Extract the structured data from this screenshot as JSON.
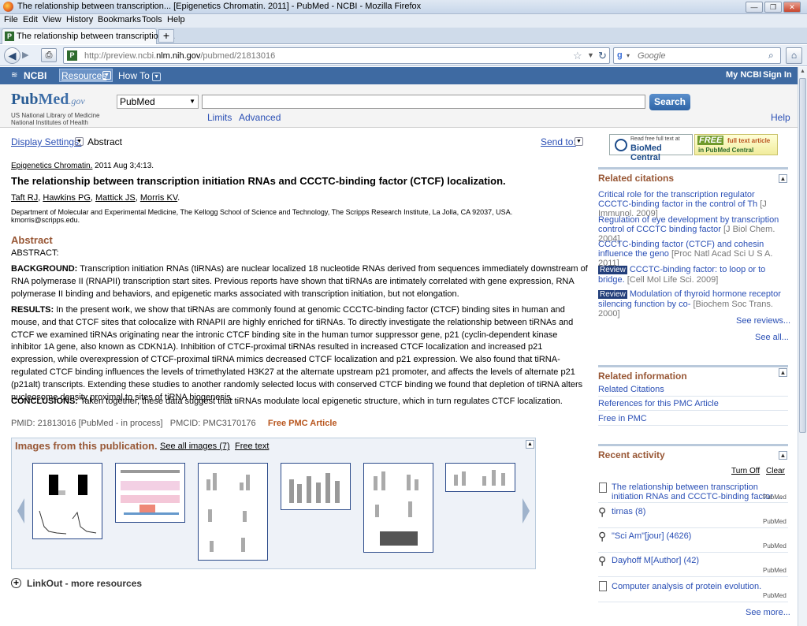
{
  "window": {
    "title": "The relationship between transcription... [Epigenetics Chromatin. 2011] - PubMed - NCBI - Mozilla Firefox"
  },
  "menubar": [
    "File",
    "Edit",
    "View",
    "History",
    "Bookmarks",
    "Tools",
    "Help"
  ],
  "tab": {
    "title": "The relationship between transcription.....",
    "new_tab": "+"
  },
  "navbar": {
    "url_prefix": "http://preview.ncbi.",
    "url_host": "nlm.nih.gov",
    "url_suffix": "/pubmed/21813016",
    "search_placeholder": "Google"
  },
  "ncbi": {
    "logo": "NCBI",
    "resources": "Resources",
    "howto": "How To",
    "my_ncbi": "My NCBI",
    "sign_in": "Sign In"
  },
  "pubmed_header": {
    "logo_pub": "Pub",
    "logo_med": "Med",
    "logo_gov": ".gov",
    "nlm_line1": "US National Library of Medicine",
    "nlm_line2": "National Institutes of Health",
    "db_selected": "PubMed",
    "search_button": "Search",
    "limits": "Limits",
    "advanced": "Advanced",
    "help": "Help"
  },
  "display": {
    "settings_label": "Display Settings:",
    "settings_value": "Abstract",
    "send_to": "Send to:"
  },
  "badges": {
    "biomed_line1": "Read free full text at",
    "biomed_line2": "BioMed Central",
    "pmc_free": "FREE",
    "pmc_line1": "full text article",
    "pmc_line2": "in PubMed Central"
  },
  "article": {
    "journal": "Epigenetics Chromatin.",
    "citation": "2011 Aug 3;4:13.",
    "title": "The relationship between transcription initiation RNAs and CCCTC-binding factor (CTCF) localization.",
    "authors": [
      "Taft RJ",
      "Hawkins PG",
      "Mattick JS",
      "Morris KV"
    ],
    "affiliation": "Department of Molecular and Experimental Medicine, The Kellogg School of Science and Technology, The Scripps Research Institute, La Jolla, CA 92037, USA.",
    "email": "kmorris@scripps.edu.",
    "abstract_heading": "Abstract",
    "abstract_label": "ABSTRACT:",
    "background_label": "BACKGROUND:",
    "background_text": "Transcription initiation RNAs (tiRNAs) are nuclear localized 18 nucleotide RNAs derived from sequences immediately downstream of RNA polymerase II (RNAPII) transcription start sites. Previous reports have shown that tiRNAs are intimately correlated with gene expression, RNA polymerase II binding and behaviors, and epigenetic marks associated with transcription initiation, but not elongation.",
    "results_label": "RESULTS:",
    "results_text": "In the present work, we show that tiRNAs are commonly found at genomic CCCTC-binding factor (CTCF) binding sites in human and mouse, and that CTCF sites that colocalize with RNAPII are highly enriched for tiRNAs. To directly investigate the relationship between tiRNAs and CTCF we examined tiRNAs originating near the intronic CTCF binding site in the human tumor suppressor gene, p21 (cyclin-dependent kinase inhibitor 1A gene, also known as CDKN1A). Inhibition of CTCF-proximal tiRNAs resulted in increased CTCF localization and increased p21 expression, while overexpression of CTCF-proximal tiRNA mimics decreased CTCF localization and p21 expression. We also found that tiRNA-regulated CTCF binding influences the levels of trimethylated H3K27 at the alternate upstream p21 promoter, and affects the levels of alternate p21 (p21alt) transcripts. Extending these studies to another randomly selected locus with conserved CTCF binding we found that depletion of tiRNA alters nucleosome density proximal to sites of tiRNA biogenesis.",
    "conclusions_label": "CONCLUSIONS:",
    "conclusions_text": "Taken together, these data suggest that tiRNAs modulate local epigenetic structure, which in turn regulates CTCF localization.",
    "pmid": "PMID: 21813016 [PubMed - in process]",
    "pmcid": "PMCID: PMC3170176",
    "free_pmc": "Free PMC Article"
  },
  "images": {
    "heading": "Images from this publication.",
    "see_all": "See all images (7)",
    "free_text": "Free text"
  },
  "linkout": "LinkOut - more resources",
  "sidebar": {
    "related_citations": {
      "heading": "Related citations",
      "items": [
        {
          "title": "Critical role for the transcription regulator CCCTC-binding factor in the control of Th",
          "cite": "[J Immunol. 2009]",
          "review": ""
        },
        {
          "title": "Regulation of eye development by transcription control of CCCTC binding factor",
          "cite": "[J Biol Chem. 2004]",
          "review": ""
        },
        {
          "title": "CCCTC-binding factor (CTCF) and cohesin influence the geno",
          "cite": "[Proc Natl Acad Sci U S A. 2011]",
          "review": ""
        },
        {
          "title": "CCCTC-binding factor: to loop or to bridge.",
          "cite": "[Cell Mol Life Sci. 2009]",
          "review": "Review"
        },
        {
          "title": "Modulation of thyroid hormone receptor silencing function by co-",
          "cite": "[Biochem Soc Trans. 2000]",
          "review": "Review"
        }
      ],
      "see_reviews": "See reviews...",
      "see_all": "See all..."
    },
    "related_information": {
      "heading": "Related information",
      "items": [
        "Related Citations",
        "References for this PMC Article",
        "Free in PMC"
      ]
    },
    "recent_activity": {
      "heading": "Recent activity",
      "turn_off": "Turn Off",
      "clear": "Clear",
      "items": [
        {
          "text": "The relationship between transcription initiation RNAs and CCCTC-binding factor ...",
          "source": "PubMed",
          "icon": "document-icon"
        },
        {
          "text": "tirnas (8)",
          "source": "PubMed",
          "icon": "search-icon"
        },
        {
          "text": "\"Sci Am\"[jour] (4626)",
          "source": "PubMed",
          "icon": "search-icon"
        },
        {
          "text": "Dayhoff M[Author] (42)",
          "source": "PubMed",
          "icon": "search-icon"
        },
        {
          "text": "Computer analysis of protein evolution.",
          "source": "PubMed",
          "icon": "document-icon"
        }
      ],
      "see_more": "See more..."
    }
  },
  "colors": {
    "ncbi_bar": "#3e6aa2",
    "link": "#2a4fb5",
    "section_heading": "#985735",
    "free_pmc": "#b8561e",
    "review_badge": "#223e7a"
  }
}
